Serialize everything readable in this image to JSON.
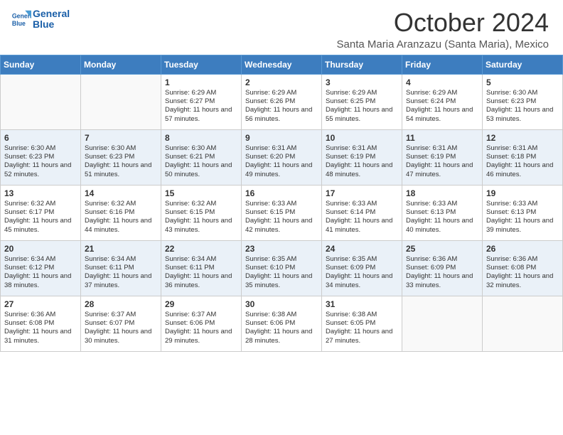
{
  "header": {
    "logo_line1": "General",
    "logo_line2": "Blue",
    "main_title": "October 2024",
    "sub_title": "Santa Maria Aranzazu (Santa Maria), Mexico"
  },
  "calendar": {
    "days_of_week": [
      "Sunday",
      "Monday",
      "Tuesday",
      "Wednesday",
      "Thursday",
      "Friday",
      "Saturday"
    ],
    "weeks": [
      [
        {
          "day": "",
          "sunrise": "",
          "sunset": "",
          "daylight": ""
        },
        {
          "day": "",
          "sunrise": "",
          "sunset": "",
          "daylight": ""
        },
        {
          "day": "1",
          "sunrise": "Sunrise: 6:29 AM",
          "sunset": "Sunset: 6:27 PM",
          "daylight": "Daylight: 11 hours and 57 minutes."
        },
        {
          "day": "2",
          "sunrise": "Sunrise: 6:29 AM",
          "sunset": "Sunset: 6:26 PM",
          "daylight": "Daylight: 11 hours and 56 minutes."
        },
        {
          "day": "3",
          "sunrise": "Sunrise: 6:29 AM",
          "sunset": "Sunset: 6:25 PM",
          "daylight": "Daylight: 11 hours and 55 minutes."
        },
        {
          "day": "4",
          "sunrise": "Sunrise: 6:29 AM",
          "sunset": "Sunset: 6:24 PM",
          "daylight": "Daylight: 11 hours and 54 minutes."
        },
        {
          "day": "5",
          "sunrise": "Sunrise: 6:30 AM",
          "sunset": "Sunset: 6:23 PM",
          "daylight": "Daylight: 11 hours and 53 minutes."
        }
      ],
      [
        {
          "day": "6",
          "sunrise": "Sunrise: 6:30 AM",
          "sunset": "Sunset: 6:23 PM",
          "daylight": "Daylight: 11 hours and 52 minutes."
        },
        {
          "day": "7",
          "sunrise": "Sunrise: 6:30 AM",
          "sunset": "Sunset: 6:23 PM",
          "daylight": "Daylight: 11 hours and 51 minutes."
        },
        {
          "day": "8",
          "sunrise": "Sunrise: 6:30 AM",
          "sunset": "Sunset: 6:21 PM",
          "daylight": "Daylight: 11 hours and 50 minutes."
        },
        {
          "day": "9",
          "sunrise": "Sunrise: 6:31 AM",
          "sunset": "Sunset: 6:20 PM",
          "daylight": "Daylight: 11 hours and 49 minutes."
        },
        {
          "day": "10",
          "sunrise": "Sunrise: 6:31 AM",
          "sunset": "Sunset: 6:19 PM",
          "daylight": "Daylight: 11 hours and 48 minutes."
        },
        {
          "day": "11",
          "sunrise": "Sunrise: 6:31 AM",
          "sunset": "Sunset: 6:19 PM",
          "daylight": "Daylight: 11 hours and 47 minutes."
        },
        {
          "day": "12",
          "sunrise": "Sunrise: 6:31 AM",
          "sunset": "Sunset: 6:18 PM",
          "daylight": "Daylight: 11 hours and 46 minutes."
        }
      ],
      [
        {
          "day": "13",
          "sunrise": "Sunrise: 6:32 AM",
          "sunset": "Sunset: 6:17 PM",
          "daylight": "Daylight: 11 hours and 45 minutes."
        },
        {
          "day": "14",
          "sunrise": "Sunrise: 6:32 AM",
          "sunset": "Sunset: 6:16 PM",
          "daylight": "Daylight: 11 hours and 44 minutes."
        },
        {
          "day": "15",
          "sunrise": "Sunrise: 6:32 AM",
          "sunset": "Sunset: 6:15 PM",
          "daylight": "Daylight: 11 hours and 43 minutes."
        },
        {
          "day": "16",
          "sunrise": "Sunrise: 6:33 AM",
          "sunset": "Sunset: 6:15 PM",
          "daylight": "Daylight: 11 hours and 42 minutes."
        },
        {
          "day": "17",
          "sunrise": "Sunrise: 6:33 AM",
          "sunset": "Sunset: 6:14 PM",
          "daylight": "Daylight: 11 hours and 41 minutes."
        },
        {
          "day": "18",
          "sunrise": "Sunrise: 6:33 AM",
          "sunset": "Sunset: 6:13 PM",
          "daylight": "Daylight: 11 hours and 40 minutes."
        },
        {
          "day": "19",
          "sunrise": "Sunrise: 6:33 AM",
          "sunset": "Sunset: 6:13 PM",
          "daylight": "Daylight: 11 hours and 39 minutes."
        }
      ],
      [
        {
          "day": "20",
          "sunrise": "Sunrise: 6:34 AM",
          "sunset": "Sunset: 6:12 PM",
          "daylight": "Daylight: 11 hours and 38 minutes."
        },
        {
          "day": "21",
          "sunrise": "Sunrise: 6:34 AM",
          "sunset": "Sunset: 6:11 PM",
          "daylight": "Daylight: 11 hours and 37 minutes."
        },
        {
          "day": "22",
          "sunrise": "Sunrise: 6:34 AM",
          "sunset": "Sunset: 6:11 PM",
          "daylight": "Daylight: 11 hours and 36 minutes."
        },
        {
          "day": "23",
          "sunrise": "Sunrise: 6:35 AM",
          "sunset": "Sunset: 6:10 PM",
          "daylight": "Daylight: 11 hours and 35 minutes."
        },
        {
          "day": "24",
          "sunrise": "Sunrise: 6:35 AM",
          "sunset": "Sunset: 6:09 PM",
          "daylight": "Daylight: 11 hours and 34 minutes."
        },
        {
          "day": "25",
          "sunrise": "Sunrise: 6:36 AM",
          "sunset": "Sunset: 6:09 PM",
          "daylight": "Daylight: 11 hours and 33 minutes."
        },
        {
          "day": "26",
          "sunrise": "Sunrise: 6:36 AM",
          "sunset": "Sunset: 6:08 PM",
          "daylight": "Daylight: 11 hours and 32 minutes."
        }
      ],
      [
        {
          "day": "27",
          "sunrise": "Sunrise: 6:36 AM",
          "sunset": "Sunset: 6:08 PM",
          "daylight": "Daylight: 11 hours and 31 minutes."
        },
        {
          "day": "28",
          "sunrise": "Sunrise: 6:37 AM",
          "sunset": "Sunset: 6:07 PM",
          "daylight": "Daylight: 11 hours and 30 minutes."
        },
        {
          "day": "29",
          "sunrise": "Sunrise: 6:37 AM",
          "sunset": "Sunset: 6:06 PM",
          "daylight": "Daylight: 11 hours and 29 minutes."
        },
        {
          "day": "30",
          "sunrise": "Sunrise: 6:38 AM",
          "sunset": "Sunset: 6:06 PM",
          "daylight": "Daylight: 11 hours and 28 minutes."
        },
        {
          "day": "31",
          "sunrise": "Sunrise: 6:38 AM",
          "sunset": "Sunset: 6:05 PM",
          "daylight": "Daylight: 11 hours and 27 minutes."
        },
        {
          "day": "",
          "sunrise": "",
          "sunset": "",
          "daylight": ""
        },
        {
          "day": "",
          "sunrise": "",
          "sunset": "",
          "daylight": ""
        }
      ]
    ]
  }
}
